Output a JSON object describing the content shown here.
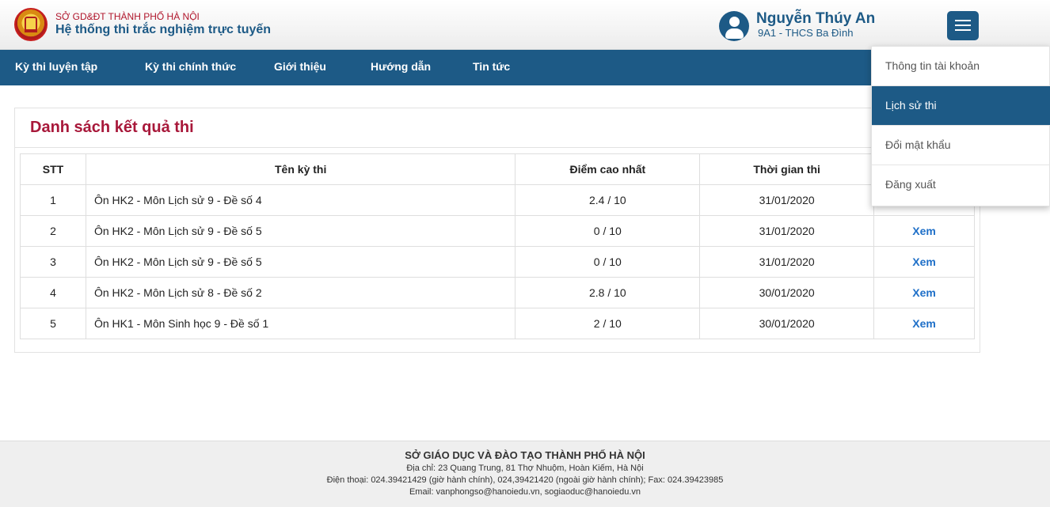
{
  "header": {
    "org_name": "SỞ GD&ĐT THÀNH PHỐ HÀ NỘI",
    "system_name": "Hệ thống thi trắc nghiệm trực tuyến",
    "user_name": "Nguyễn Thúy An",
    "user_class": "9A1 - THCS Ba Đình"
  },
  "nav": {
    "items": [
      {
        "label": "Kỳ thi luyện tập"
      },
      {
        "label": "Kỳ thi chính thức"
      },
      {
        "label": "Giới thiệu"
      },
      {
        "label": "Hướng dẫn"
      },
      {
        "label": "Tin tức"
      }
    ]
  },
  "dropdown": {
    "items": [
      {
        "label": "Thông tin tài khoản"
      },
      {
        "label": "Lịch sử thi"
      },
      {
        "label": "Đổi mật khẩu"
      },
      {
        "label": "Đăng xuất"
      }
    ],
    "active_label": "Lịch sử thi"
  },
  "results": {
    "title": "Danh sách kết quả thi",
    "columns": [
      "STT",
      "Tên kỳ thi",
      "Điểm cao nhất",
      "Thời gian thi",
      ""
    ],
    "rows": [
      {
        "stt": "1",
        "name": "Ôn HK2 - Môn Lịch sử 9 - Đề số 4",
        "score": "2.4 / 10",
        "date": "31/01/2020",
        "action": ""
      },
      {
        "stt": "2",
        "name": "Ôn HK2 - Môn Lịch sử 9 - Đề số 5",
        "score": "0 / 10",
        "date": "31/01/2020",
        "action": "Xem"
      },
      {
        "stt": "3",
        "name": "Ôn HK2 - Môn Lịch sử 9 - Đề số 5",
        "score": "0 / 10",
        "date": "31/01/2020",
        "action": "Xem"
      },
      {
        "stt": "4",
        "name": "Ôn HK2 - Môn Lịch sử 8 - Đề số 2",
        "score": "2.8 / 10",
        "date": "30/01/2020",
        "action": "Xem"
      },
      {
        "stt": "5",
        "name": "Ôn HK1 - Môn Sinh học 9 - Đề số 1",
        "score": "2 / 10",
        "date": "30/01/2020",
        "action": "Xem"
      }
    ]
  },
  "footer": {
    "title": "SỞ GIÁO DỤC VÀ ĐÀO TẠO THÀNH PHỐ HÀ NỘI",
    "address": "Địa chỉ: 23 Quang Trung, 81 Thợ Nhuộm, Hoàn Kiếm, Hà Nội",
    "phone": "Điện thoại: 024.39421429 (giờ hành chính), 024,39421420 (ngoài giờ hành chính); Fax: 024.39423985",
    "email": "Email: vanphongso@hanoiedu.vn, sogiaoduc@hanoiedu.vn"
  },
  "colors": {
    "primary": "#1d5a86",
    "title_red": "#a8183a",
    "link_blue": "#1e6fc8"
  }
}
